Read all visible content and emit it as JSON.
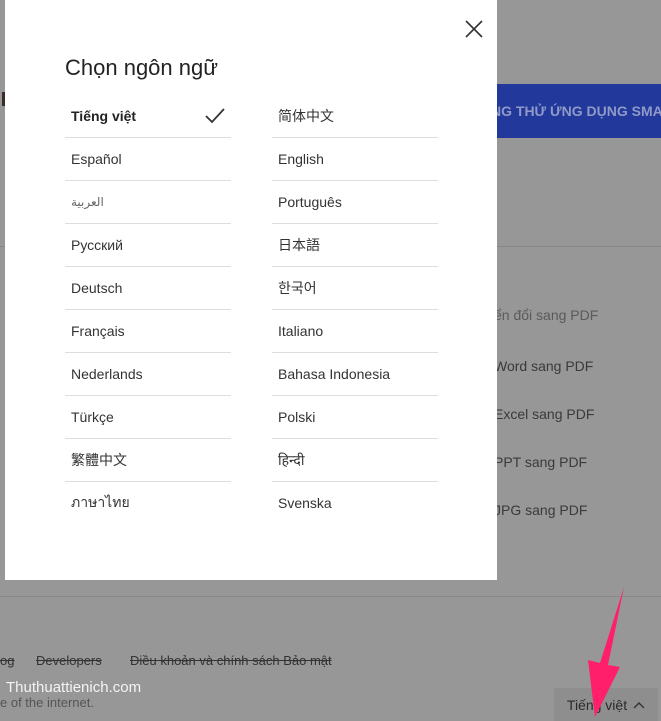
{
  "background": {
    "banner_text": "NG THỬ ỨNG DỤNG SMAL",
    "links": [
      "ển đổi sang PDF",
      "Word sang PDF",
      "Excel sang PDF",
      "PPT sang PDF",
      "JPG sang PDF"
    ],
    "footer_links": [
      "og",
      "Developers",
      "Điều khoản và chính sách Bảo mật"
    ],
    "tagline": "e of the internet.",
    "watermark": "Thuthuattienich.com",
    "language_button": "Tiếng việt",
    "accent_color": "#22389a",
    "arrow_color": "#ff1f6b"
  },
  "modal": {
    "title": "Chọn ngôn ngữ",
    "close_icon": "close-icon",
    "selected": "Tiếng việt",
    "left_column": [
      "Tiếng việt",
      "Español",
      "العربية",
      "Русский",
      "Deutsch",
      "Français",
      "Nederlands",
      "Türkçe",
      "繁體中文",
      "ภาษาไทย"
    ],
    "right_column": [
      "简体中文",
      "English",
      "Português",
      "日本語",
      "한국어",
      "Italiano",
      "Bahasa Indonesia",
      "Polski",
      "हिन्दी",
      "Svenska"
    ]
  }
}
